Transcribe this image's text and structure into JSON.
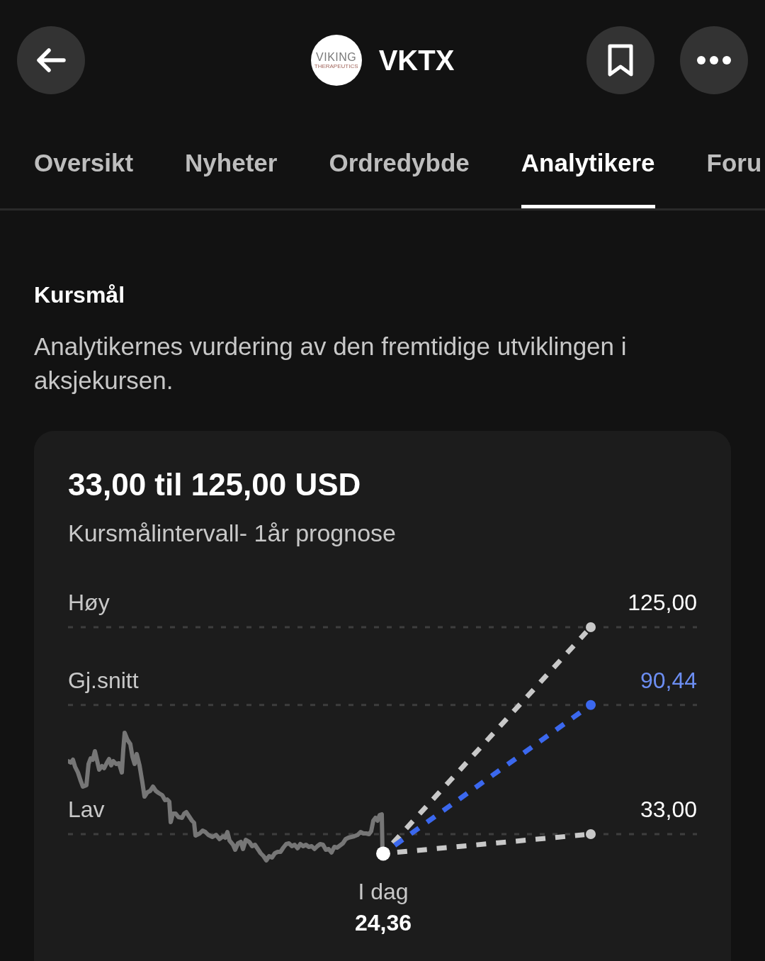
{
  "header": {
    "logo": {
      "wordmark": "VIKING",
      "tagline": "THERAPEUTICS"
    },
    "ticker": "VKTX"
  },
  "tabs": [
    {
      "label": "Oversikt",
      "selected": false
    },
    {
      "label": "Nyheter",
      "selected": false
    },
    {
      "label": "Ordredybde",
      "selected": false
    },
    {
      "label": "Analytikere",
      "selected": true
    },
    {
      "label": "Foru",
      "selected": false
    }
  ],
  "section": {
    "title": "Kursmål",
    "description": "Analytikernes vurdering av den fremtidige utviklingen i aksjekursen."
  },
  "target_card": {
    "range": "33,00 til 125,00 USD",
    "subtitle": "Kursmålintervall- 1år prognose",
    "targets": [
      {
        "label": "Høy",
        "value": "125,00",
        "color": "#c8c8c8",
        "kind": "range"
      },
      {
        "label": "Gj.snitt",
        "value": "90,44",
        "color": "#3b68ee",
        "kind": "average"
      },
      {
        "label": "Lav",
        "value": "33,00",
        "color": "#c8c8c8",
        "kind": "range"
      }
    ],
    "today": {
      "label": "I dag",
      "value": "24,36"
    }
  }
}
